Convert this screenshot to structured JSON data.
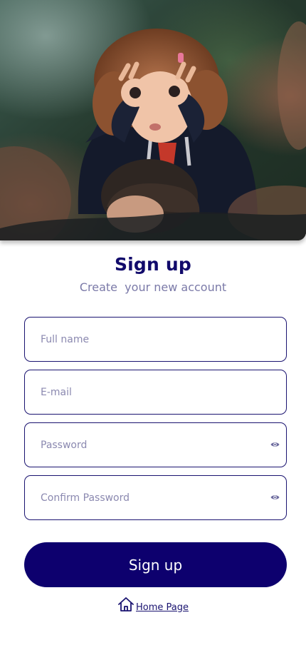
{
  "header": {
    "title": "Sign up",
    "subtitle": "Create  your new account"
  },
  "form": {
    "full_name": {
      "placeholder": "Full name",
      "value": ""
    },
    "email": {
      "placeholder": "E-mail",
      "value": ""
    },
    "password": {
      "placeholder": "Password",
      "value": "",
      "icon": "eye-icon"
    },
    "confirm_password": {
      "placeholder": "Confirm Password",
      "value": "",
      "icon": "eye-icon"
    }
  },
  "actions": {
    "signup_label": "Sign up",
    "home_label": "Home Page",
    "home_icon": "home-icon"
  },
  "colors": {
    "primary": "#0d006e",
    "title": "#110a6b",
    "subtitle": "#7b7aa8",
    "placeholder": "#8b89b0",
    "background": "#ffffff"
  }
}
